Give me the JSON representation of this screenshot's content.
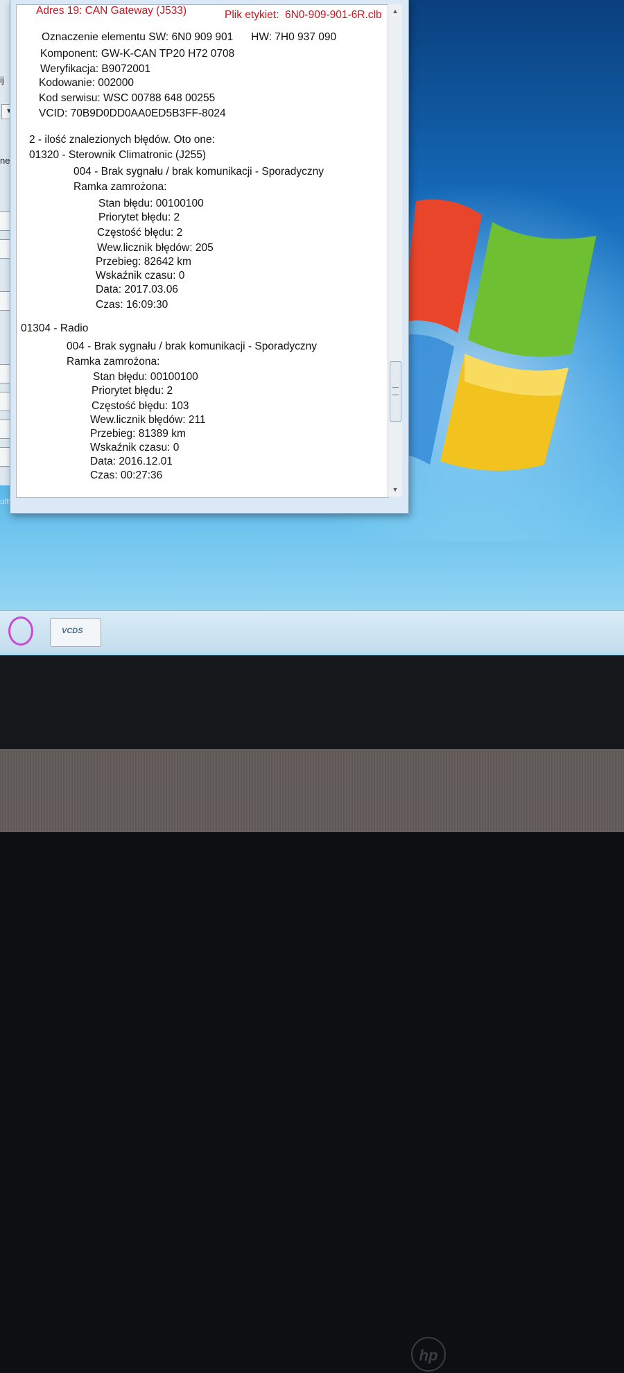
{
  "window": {
    "title_left": "Adres 19: CAN Gateway (J533)",
    "title_right": "Plik etykiet:  6N0-909-901-6R.clb"
  },
  "report_lines": [
    "Oznaczenie elementu SW: 6N0 909 901      HW: 7H0 937 090",
    "Komponent: GW-K-CAN TP20 H72 0708",
    "Weryfikacja: B9072001",
    "Kodowanie: 002000",
    "Kod serwisu: WSC 00788 648 00255",
    "VCID: 70B9D0DD0AA0ED5B3FF-8024",
    "2 - ilość znalezionych błędów. Oto one:",
    "01320 - Sterownik Climatronic (J255)",
    "004 - Brak sygnału / brak komunikacji - Sporadyczny",
    "Ramka zamrożona:",
    "Stan błędu: 00100100",
    "Priorytet błędu: 2",
    "Częstość błędu: 2",
    "Wew.licznik błędów: 205",
    "Przebieg: 82642 km",
    "Wskaźnik czasu: 0",
    "Data: 2017.03.06",
    "Czas: 16:09:30",
    "01304 - Radio",
    "004 - Brak sygnału / brak komunikacji - Sporadyczny",
    "Ramka zamrożona:",
    "Stan błędu: 00100100",
    "Priorytet błędu: 2",
    "Częstość błędu: 103",
    "Wew.licznik błędów: 211",
    "Przebieg: 81389 km",
    "Wskaźnik czasu: 0",
    "Data: 2016.12.01",
    "Czas: 00:27:36"
  ],
  "background_app": {
    "label1": "ij",
    "label2": "nej",
    "label3": "ulty"
  },
  "taskbar": {
    "vcds_label": "VCDS"
  },
  "bezel": {
    "logo": "hp"
  },
  "colors": {
    "title_red": "#d0111b",
    "window_bg": "#dbe8f5"
  }
}
